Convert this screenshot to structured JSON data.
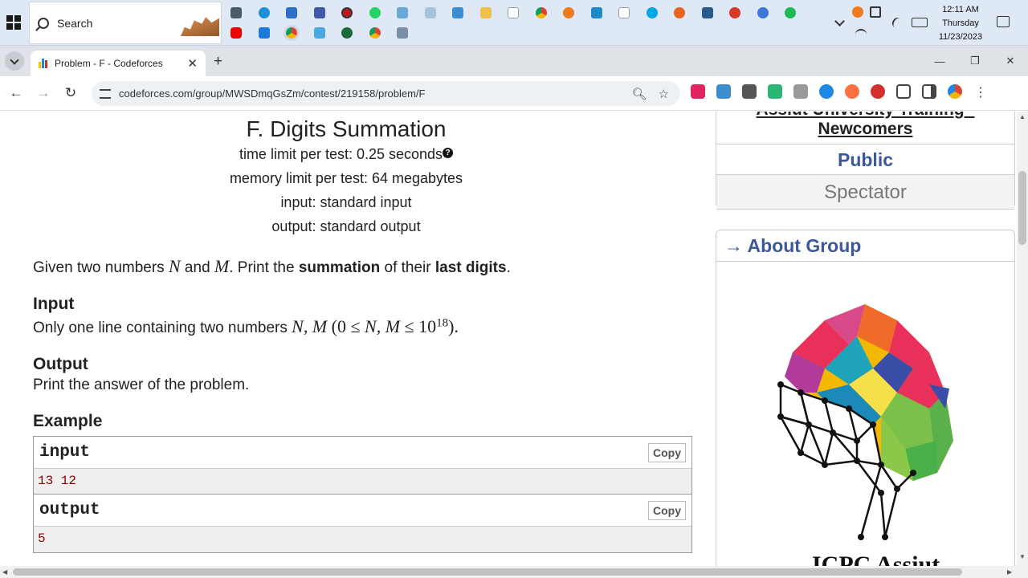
{
  "taskbar": {
    "search_label": "Search",
    "clock_time": "12:11 AM",
    "clock_day": "Thursday",
    "clock_date": "11/23/2023"
  },
  "browser": {
    "tab_title": "Problem - F - Codeforces",
    "url": "codeforces.com/group/MWSDmqGsZm/contest/219158/problem/F"
  },
  "problem": {
    "title": "F. Digits Summation",
    "time_limit": "time limit per test: 0.25 seconds",
    "memory_limit": "memory limit per test: 64 megabytes",
    "input_file": "input: standard input",
    "output_file": "output: standard output",
    "statement": {
      "pre": "Given two numbers ",
      "var_n": "N",
      "and": " and ",
      "var_m": "M",
      "mid": ". Print the ",
      "bold1": "summation",
      "mid2": " of their ",
      "bold2": "last digits",
      "end": "."
    },
    "input_title": "Input",
    "input_text": {
      "pre": "Only one line containing two numbers ",
      "vars": "N, M",
      "open": " (0 ≤ ",
      "v1": "N, M",
      "le": " ≤ 10",
      "exp": "18",
      "close": ")."
    },
    "output_title": "Output",
    "output_text": "Print the answer of the problem.",
    "example_title": "Example",
    "sample_input_label": "input",
    "sample_input": "13 12",
    "sample_output_label": "output",
    "sample_output": "5",
    "copy_label": "Copy"
  },
  "sidebar": {
    "group_line1": "Assiut University Training -",
    "group_line2": "Newcomers",
    "public": "Public",
    "spectator": "Spectator",
    "about": "→ About Group",
    "logo_text": "ICPC Assiut"
  },
  "colors": {
    "link_blue": "#3b5998",
    "sample_text": "#8b0000"
  }
}
